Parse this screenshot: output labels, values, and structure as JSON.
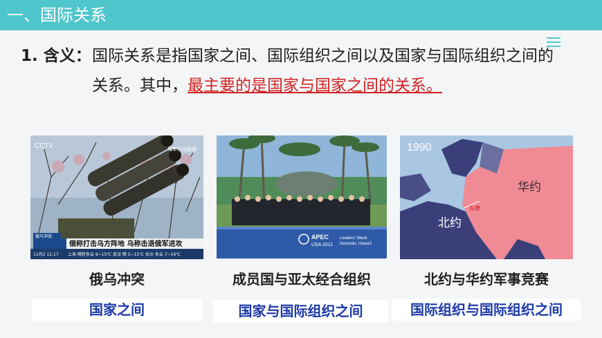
{
  "header": {
    "title": "一、国际关系"
  },
  "definition": {
    "label": "1. 含义：",
    "line1": "国际关系是指国家之间、国际组织之间以及国家与国际组织之间的",
    "line2_plain": "关系。其中，",
    "line2_highlight": "最主要的是国家与国家之间的关系。"
  },
  "photos": [
    {
      "caption": "俄乌冲突",
      "tag": "国家之间",
      "overlay": {
        "channel": "CCTV",
        "corner": "乌军行动画面",
        "topic": "俄乌冲突",
        "headline": "俄称打击乌方阵地 乌称击退俄军进攻",
        "time": "11月2 11:17",
        "ticker": "上海 晴转多云 9~15℃ 武汉 晴 5~15℃ 长沙 多云 7~16℃"
      }
    },
    {
      "caption": "成员国与亚太经合组织",
      "tag": "国家与国际组织之间",
      "banner": {
        "line1": "APEC",
        "line2": "USA 2011",
        "right1": "Leaders' Week",
        "right2": "Honolulu, Hawai'i"
      }
    },
    {
      "caption": "北约与华约军事竞赛",
      "tag": "国际组织与国际组织之间",
      "map": {
        "year": "1990",
        "label_warsaw": "华约",
        "label_nato": "北约",
        "label_side": "东德"
      }
    }
  ],
  "colors": {
    "header": "#4fc6cc",
    "highlight": "#d12222",
    "tag_text": "#1d3aa8",
    "nato": "#3a3f7a",
    "warsaw": "#f08a94",
    "sea": "#a9c7e3"
  }
}
